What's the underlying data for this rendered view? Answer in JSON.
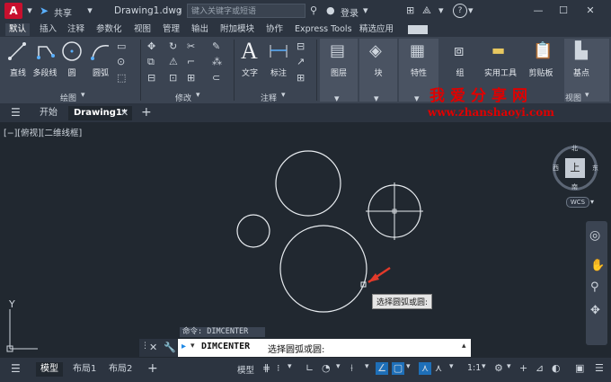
{
  "titlebar": {
    "share_label": "共享",
    "doc_title": "Drawing1.dwg",
    "search_placeholder": "键入关键字或短语",
    "login_label": "登录"
  },
  "ribbon_tabs": [
    "默认",
    "插入",
    "注释",
    "参数化",
    "视图",
    "管理",
    "输出",
    "附加模块",
    "协作",
    "Express Tools",
    "精选应用"
  ],
  "ribbon": {
    "draw_tools": [
      "直线",
      "多段线",
      "圆",
      "圆弧"
    ],
    "annotate_tools": [
      "文字",
      "标注"
    ],
    "big_tools": [
      "图层",
      "块",
      "特性",
      "组",
      "实用工具",
      "剪贴板",
      "基点"
    ],
    "panels": {
      "draw": "绘图",
      "modify": "修改",
      "annotate": "注释",
      "view": "视图"
    }
  },
  "doc_tabs": {
    "start": "开始",
    "drawing": "Drawing1*"
  },
  "viewport": {
    "label": "[−][俯视][二维线框]",
    "tooltip": "选择圆弧或圆:",
    "wcs": "WCS",
    "cube_face": "上",
    "compass": {
      "n": "北",
      "s": "南",
      "e": "东",
      "w": "西"
    },
    "ucs_y": "Y"
  },
  "command": {
    "history": "命令: DIMCENTER",
    "current_cmd": "DIMCENTER",
    "current_prompt": "选择圆弧或圆:"
  },
  "statusbar": {
    "layout_tabs": [
      "模型",
      "布局1",
      "布局2"
    ],
    "model_btn": "模型",
    "scale": "1:1"
  },
  "watermark": {
    "title": "我爱分享网",
    "url": "www.zhanshaoyi.com"
  },
  "colors": {
    "accent": "#1e88e5",
    "logo": "#c8102e",
    "watermark": "#e00000"
  }
}
